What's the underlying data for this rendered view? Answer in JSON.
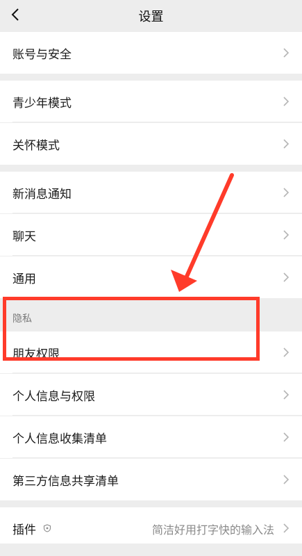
{
  "nav": {
    "title": "设置",
    "back_icon": "chevron-left-icon"
  },
  "items": [
    {
      "label": "账号与安全"
    },
    {
      "label": "青少年模式"
    },
    {
      "label": "关怀模式"
    },
    {
      "label": "新消息通知"
    },
    {
      "label": "聊天"
    },
    {
      "label": "通用"
    },
    {
      "label": "朋友权限"
    },
    {
      "label": "个人信息与权限"
    },
    {
      "label": "个人信息收集清单"
    },
    {
      "label": "第三方信息共享清单"
    },
    {
      "label": "插件",
      "value": "简洁好用打字快的输入法"
    }
  ],
  "section_header": "隐私",
  "annotation": {
    "color": "#ff3b2a"
  }
}
